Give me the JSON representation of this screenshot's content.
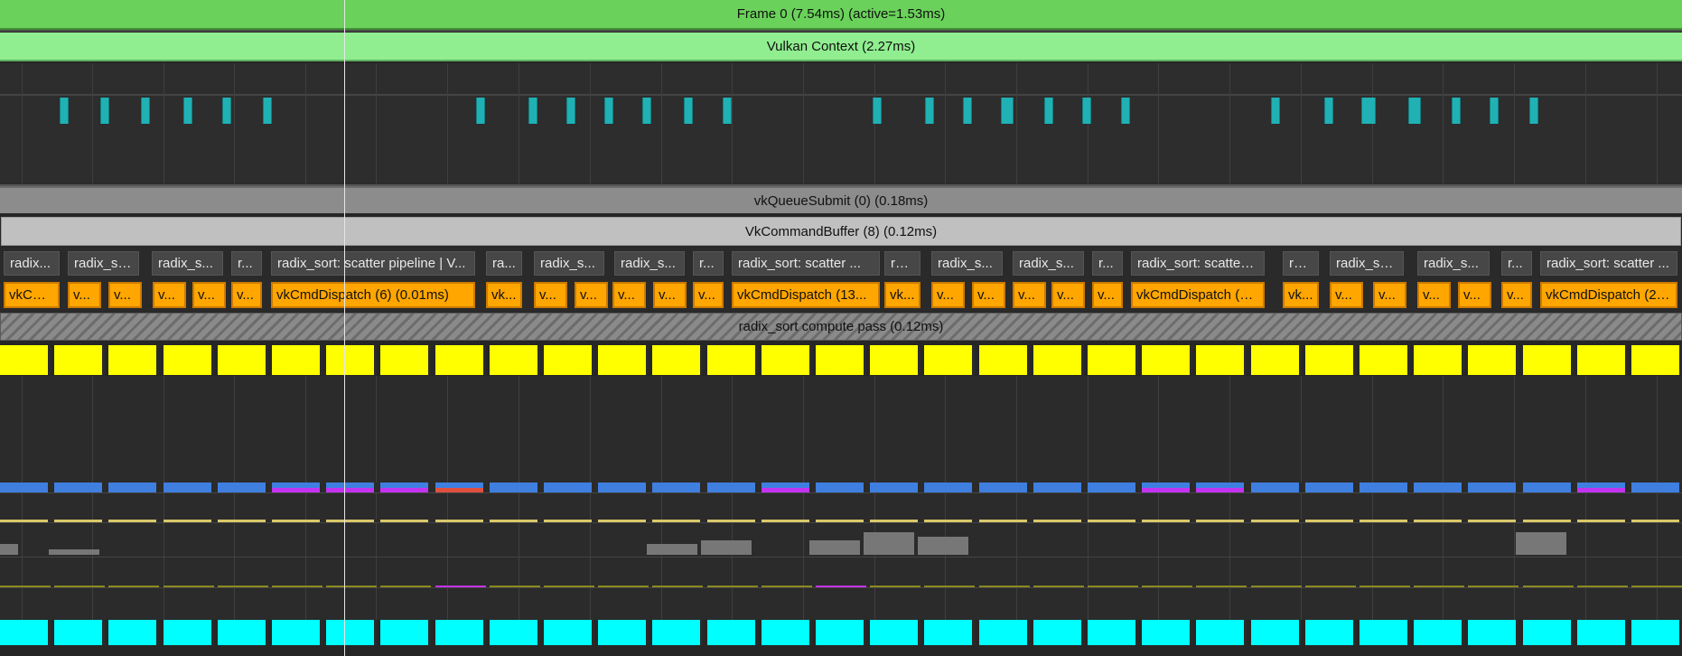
{
  "frame": {
    "label": "Frame 0 (7.54ms) (active=1.53ms)",
    "color": "#6ad25a"
  },
  "context": {
    "label": "Vulkan Context (2.27ms)",
    "color": "#90ee90"
  },
  "queue_submit": {
    "label": "vkQueueSubmit (0) (0.18ms)"
  },
  "command_buffer": {
    "label": "VkCommandBuffer (8) (0.12ms)"
  },
  "compute_pass": {
    "label": "radix_sort compute pass (0.12ms)"
  },
  "debug_labels": [
    "radix...",
    "radix_so...",
    "radix_s...",
    "r...",
    "radix_sort: scatter pipeline | V...",
    "ra...",
    "radix_s...",
    "radix_s...",
    "r...",
    "radix_sort: scatter ...",
    "rad...",
    "radix_s...",
    "radix_s...",
    "r...",
    "radix_sort: scatter ...",
    "rad...",
    "radix_so...",
    "radix_s...",
    "r...",
    "radix_sort: scatter ..."
  ],
  "dispatch_labels": [
    "vkCm...",
    "v...",
    "v...",
    "v...",
    "v...",
    "v...",
    "vkCmdDispatch (6) (0.01ms)",
    "vk...",
    "v...",
    "v...",
    "v...",
    "v...",
    "v...",
    "vkCmdDispatch (13...",
    "vk...",
    "v...",
    "v...",
    "v...",
    "v...",
    "v...",
    "vkCmdDispatch (20...",
    "vk...",
    "v...",
    "v...",
    "v...",
    "v...",
    "v...",
    "vkCmdDispatch (27..."
  ],
  "colors": {
    "yellow_cells": "#ffff00",
    "cyan_cells": "#00ffff",
    "dispatch": "#ffa600",
    "marker": "#1fb1b4",
    "blue_bar": "#3f7fe0",
    "purple_accent": "#c433f0"
  }
}
